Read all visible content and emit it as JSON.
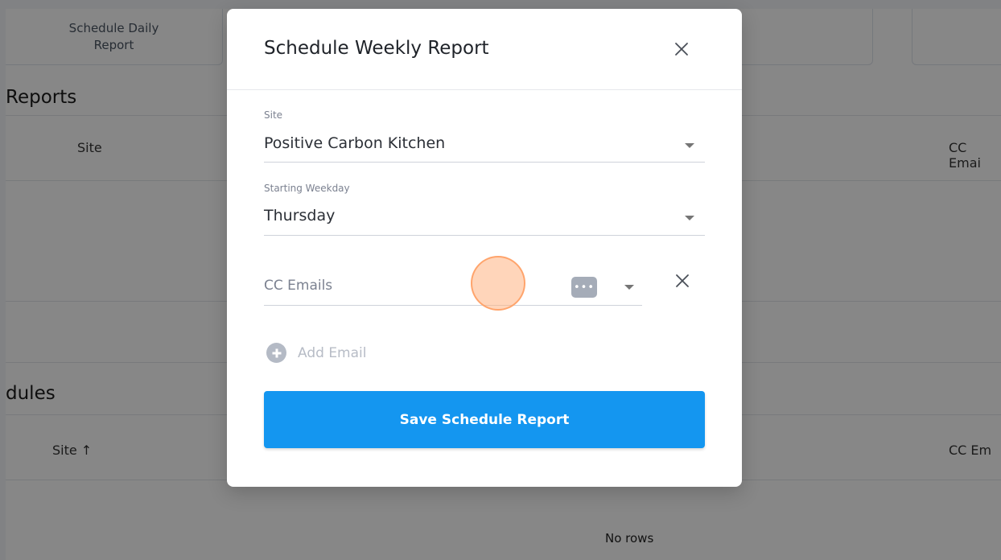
{
  "background": {
    "daily_card": {
      "label": "Schedule Daily Report"
    },
    "reports_section": {
      "title": "Reports",
      "columns": [
        "Site",
        "CC Emai"
      ]
    },
    "schedules_section": {
      "title": "dules",
      "columns": [
        "Site ↑",
        "CC Em"
      ],
      "empty_text": "No rows"
    }
  },
  "modal": {
    "title": "Schedule Weekly Report",
    "close_icon": "close-icon",
    "fields": {
      "site": {
        "label": "Site",
        "value": "Positive Carbon Kitchen"
      },
      "starting_weekday": {
        "label": "Starting Weekday",
        "value": "Thursday"
      },
      "cc_emails": {
        "placeholder": "CC Emails",
        "more_icon": "ellipsis-icon",
        "dots": "•••"
      }
    },
    "add_email_label": "Add Email",
    "save_button_label": "Save Schedule Report"
  },
  "colors": {
    "primary": "#1496f0",
    "overlay": "rgba(0,0,0,0.47)",
    "click_marker": "#ffb282"
  }
}
